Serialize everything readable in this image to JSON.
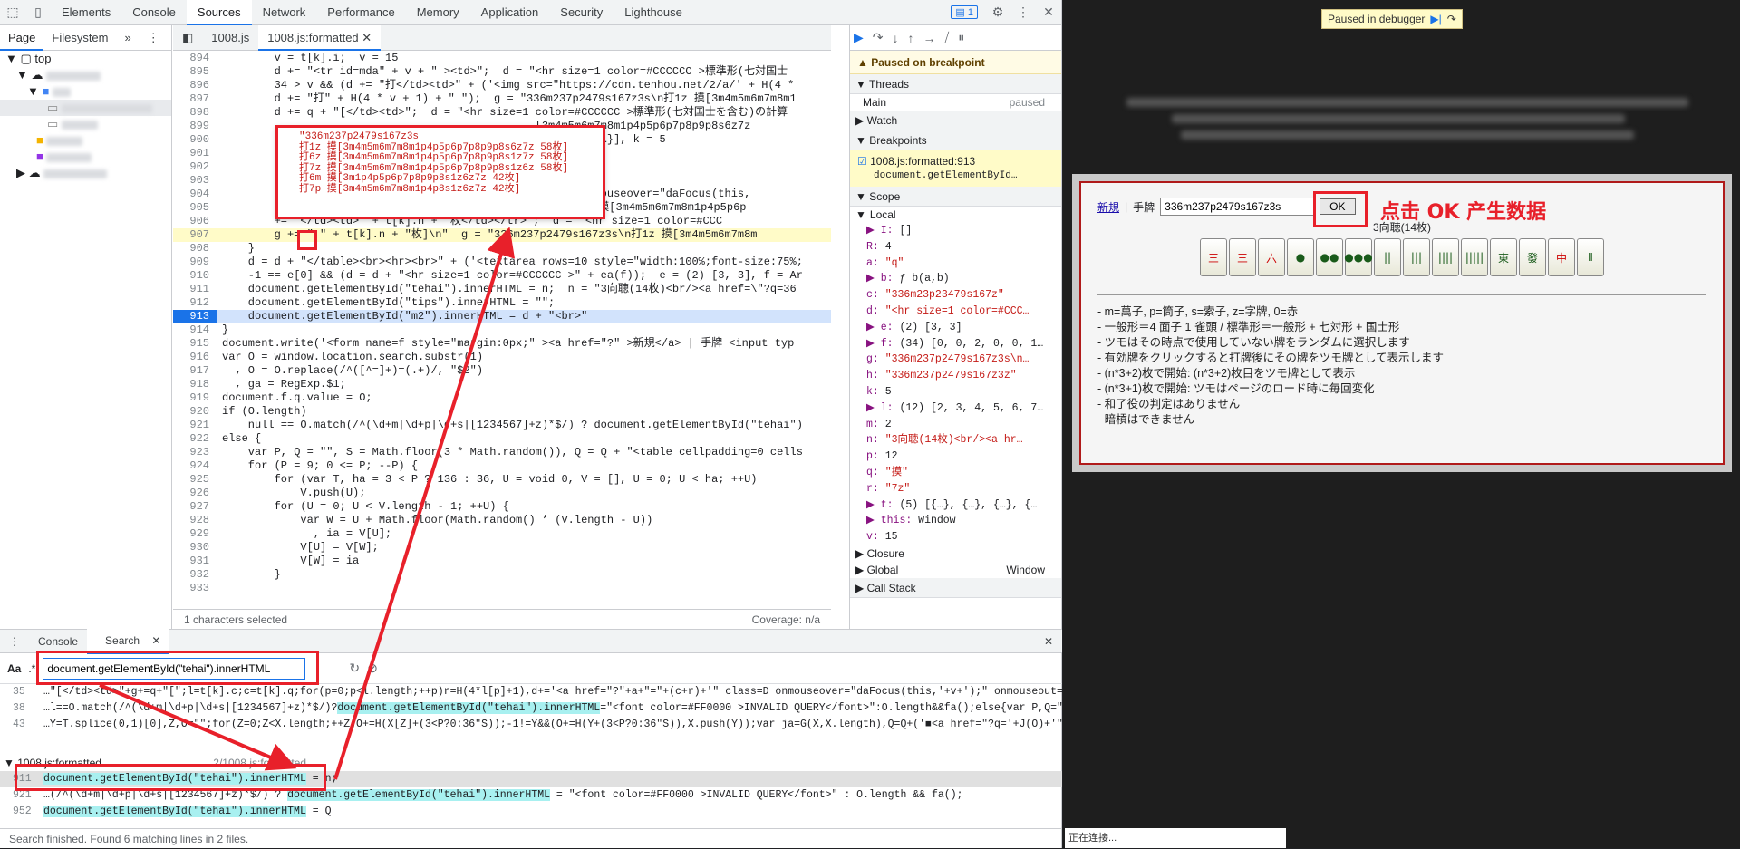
{
  "topbar": {
    "tabs": [
      "Elements",
      "Console",
      "Sources",
      "Network",
      "Performance",
      "Memory",
      "Application",
      "Security",
      "Lighthouse"
    ],
    "badge": "1"
  },
  "navigator": {
    "tabs": [
      "Page",
      "Filesystem"
    ],
    "top": "top"
  },
  "editor": {
    "tabs": [
      "1008.js",
      "1008.js:formatted"
    ],
    "lines": [
      {
        "n": "894",
        "t": "        v = t[k].i;  v = 15"
      },
      {
        "n": "895",
        "t": "        d += \"<tr id=mda\" + v + \" ><td>\";  d = \"<hr size=1 color=#CCCCCC >標準形(七対国士"
      },
      {
        "n": "896",
        "t": "        34 > v && (d += \"打</td><td>\" + ('<img src=\"https://cdn.tenhou.net/2/a/' + H(4 *"
      },
      {
        "n": "897",
        "t": "        d += \"打\" + H(4 * v + 1) + \" \");  g = \"336m237p2479s167z3s\\n打1z 摸[3m4m5m6m7m8m1"
      },
      {
        "n": "898",
        "t": "        d += q + \"[</td><td>\";  d = \"<hr size=1 color=#CCCCCC >標準形(七対国士を含む)の計算"
      },
      {
        "n": "899",
        "t": "                                                [3m4m5m6m7m8m1p4p5p6p7p8p9p8s6z7z"
      },
      {
        "n": "900",
        "t": "                                                …}, {…}, {…}], k = 5"
      },
      {
        "n": "901",
        "t": ""
      },
      {
        "n": "902",
        "t": "                                                ay(12)"
      },
      {
        "n": "903",
        "t": ""
      },
      {
        "n": "904",
        "t": "                                                lass=D onmouseover=\"daFocus(this,"
      },
      {
        "n": "905",
        "t": "                                                z3s\\n打1z 摸[3m4m5m6m7m8m1p4p5p6p"
      },
      {
        "n": "906",
        "t": "        += \"</td><td>\" + t[k].n + \"枚</td></tr>\";  d = \"<hr size=1 color=#CCC"
      },
      {
        "n": "907",
        "t": "        g += \" \" + t[k].n + \"枚]\\n\"  g = \"336m237p2479s167z3s\\n打1z 摸[3m4m5m6m7m8m"
      },
      {
        "n": "908",
        "t": "    }"
      },
      {
        "n": "909",
        "t": "    d = d + \"</table><br><hr><br>\" + ('<textarea rows=10 style=\"width:100%;font-size:75%;"
      },
      {
        "n": "910",
        "t": "    -1 == e[0] && (d = d + \"<hr size=1 color=#CCCCCC >\" + ea(f));  e = (2) [3, 3], f = Ar"
      },
      {
        "n": "911",
        "t": "    document.getElementById(\"tehai\").innerHTML = n;  n = \"3向聴(14枚)<br/><a href=\\\"?q=36"
      },
      {
        "n": "912",
        "t": "    document.getElementById(\"tips\").innerHTML = \"\";"
      },
      {
        "n": "913",
        "t": "    document.getElementById(\"m2\").innerHTML = d + \"<br>\""
      },
      {
        "n": "914",
        "t": "}"
      },
      {
        "n": "915",
        "t": "document.write('<form name=f style=\"margin:0px;\" ><a href=\"?\" >新規</a> | 手牌 <input typ"
      },
      {
        "n": "916",
        "t": "var O = window.location.search.substr(1)"
      },
      {
        "n": "917",
        "t": "  , O = O.replace(/^([^=]+)=(.+)/, \"$2\")"
      },
      {
        "n": "918",
        "t": "  , ga = RegExp.$1;"
      },
      {
        "n": "919",
        "t": "document.f.q.value = O;"
      },
      {
        "n": "920",
        "t": "if (O.length)"
      },
      {
        "n": "921",
        "t": "    null == O.match(/^(\\d+m|\\d+p|\\d+s|[1234567]+z)*$/) ? document.getElementById(\"tehai\")"
      },
      {
        "n": "922",
        "t": "else {"
      },
      {
        "n": "923",
        "t": "    var P, Q = \"\", S = Math.floor(3 * Math.random()), Q = Q + \"<table cellpadding=0 cells"
      },
      {
        "n": "924",
        "t": "    for (P = 9; 0 <= P; --P) {"
      },
      {
        "n": "925",
        "t": "        for (var T, ha = 3 < P ? 136 : 36, U = void 0, V = [], U = 0; U < ha; ++U)"
      },
      {
        "n": "926",
        "t": "            V.push(U);"
      },
      {
        "n": "927",
        "t": "        for (U = 0; U < V.length - 1; ++U) {"
      },
      {
        "n": "928",
        "t": "            var W = U + Math.floor(Math.random() * (V.length - U))"
      },
      {
        "n": "929",
        "t": "              , ia = V[U];"
      },
      {
        "n": "930",
        "t": "            V[U] = V[W];"
      },
      {
        "n": "931",
        "t": "            V[W] = ia"
      },
      {
        "n": "932",
        "t": "        }"
      },
      {
        "n": "933",
        "t": ""
      }
    ],
    "tooltip": "\"336m237p2479s167z3s\n打1z 摸[3m4m5m6m7m8m1p4p5p6p7p8p9p8s6z7z 58枚]\n打6z 摸[3m4m5m6m7m8m1p4p5p6p7p8p9p8s1z7z 58枚]\n打7z 摸[3m4m5m6m7m8m1p4p5p6p7p8p9p8s1z6z 58枚]\n打6m 摸[3m1p4p5p6p7p8p9p8s1z6z7z 42枚]\n打7p 摸[3m4m5m6m7m8m1p4p8s1z6z7z 42枚]",
    "status_left": "1 characters selected",
    "status_right": "Coverage: n/a"
  },
  "debugger": {
    "paused": "Paused on breakpoint",
    "threads_label": "Threads",
    "main_label": "Main",
    "main_status": "paused",
    "watch_label": "Watch",
    "breakpoints_label": "Breakpoints",
    "bp_file": "1008.js:formatted:913",
    "bp_code": "document.getElementById…",
    "scope_label": "Scope",
    "local_label": "Local",
    "scope": [
      [
        "▶ I:",
        " []"
      ],
      [
        "  R:",
        " 4"
      ],
      [
        "  a:",
        " \"q\""
      ],
      [
        "▶ b:",
        " ƒ b(a,b)"
      ],
      [
        "  c:",
        " \"336m23p23479s167z\""
      ],
      [
        "  d:",
        " \"<hr size=1 color=#CCC…"
      ],
      [
        "▶ e:",
        " (2) [3, 3]"
      ],
      [
        "▶ f:",
        " (34) [0, 0, 2, 0, 0, 1…"
      ],
      [
        "  g:",
        " \"336m237p2479s167z3s\\n…"
      ],
      [
        "  h:",
        " \"336m237p2479s167z3z\""
      ],
      [
        "  k:",
        " 5"
      ],
      [
        "▶ l:",
        " (12) [2, 3, 4, 5, 6, 7…"
      ],
      [
        "  m:",
        " 2"
      ],
      [
        "  n:",
        " \"3向聴(14枚)<br/><a hr…"
      ],
      [
        "  p:",
        " 12"
      ],
      [
        "  q:",
        " \"摸\""
      ],
      [
        "  r:",
        " \"7z\""
      ],
      [
        "▶ t:",
        " (5) [{…}, {…}, {…}, {…"
      ],
      [
        "▶ this:",
        " Window"
      ],
      [
        "  v:",
        " 15"
      ]
    ],
    "closure_label": "Closure",
    "global_label": "Global",
    "global_value": "Window",
    "callstack_label": "Call Stack"
  },
  "drawer": {
    "tabs": [
      "Console",
      "Search"
    ],
    "aa": "Aa",
    "regex": ".*",
    "query": "document.getElementById(\"tehai\").innerHTML",
    "results_top": [
      {
        "n": "35",
        "pre": "…\"[</td><td>\"+g+=q+\"[\";l=t[k].c;c=t[k].q;for(p=0;p<l.length;++p)r=H(4*l[p]+1),d+='<a href=\"?\"+a+\"=\"+(c+r)+'\" class=D onmouseover=\"daFocus(this,'+v+');\" onmouseout=\"daUnfocus();\">…",
        "m": "",
        "post": ""
      },
      {
        "n": "38",
        "pre": "…l==O.match(/^(\\d+m|\\d+p|\\d+s|[1234567]+z)*$/)?",
        "m": "document.getElementById(\"tehai\").innerHTML",
        "post": "=\"<font color=#FF0000 >INVALID QUERY</font>\":O.length&&fa();else{var P,Q=\"\",S=Math…"
      },
      {
        "n": "43",
        "pre": "…Y=T.splice(0,1)[0],Z,O=\"\";for(Z=0;Z<X.length;++Z)O+=H(X[Z]+(3<P?0:36\"S));-1!=Y&&(O+=H(Y+(3<P?0:36\"S)),X.push(Y));var ja=G(X,X.length),Q=Q+('■<a href=\"?q='+J(O)+'\" class=D >'),Q…",
        "m": "",
        "post": ""
      }
    ],
    "file2": "1008.js:formatted",
    "file2_path": "2/1008.js:formatted",
    "results_bottom": [
      {
        "n": "911",
        "pre": "",
        "m": "document.getElementById(\"tehai\").innerHTML",
        "post": " = n;"
      },
      {
        "n": "921",
        "pre": "…(/^(\\d+m|\\d+p|\\d+s|[1234567]+z)*$/) ? ",
        "m": "document.getElementById(\"tehai\").innerHTML",
        "post": " = \"<font color=#FF0000 >INVALID QUERY</font>\" : O.length && fa();"
      },
      {
        "n": "952",
        "pre": "",
        "m": "document.getElementById(\"tehai\").innerHTML",
        "post": " = Q"
      }
    ],
    "status": "Search finished.  Found 6 matching lines in 2 files."
  },
  "page": {
    "paused_banner": "Paused in debugger",
    "new_link": "新規",
    "hand_label": "手牌",
    "query_value": "336m237p2479s167z3s",
    "ok": "OK",
    "annotation": "点击 OK 产生数据",
    "shanten": "3向聴(14枚)",
    "tiles": [
      "三",
      "三",
      "六",
      "●",
      "●●",
      "●●●",
      "||",
      "|||",
      "||||",
      "|||||",
      "東",
      "發",
      "中",
      "Ⅱ"
    ],
    "rules": [
      "- m=萬子, p=筒子, s=索子, z=字牌, 0=赤",
      "- 一般形＝4 面子 1 雀頭 / 標準形＝一般形 + 七対形 + 国士形",
      "- ツモはその時点で使用していない牌をランダムに選択します",
      "- 有効牌をクリックすると打牌後にその牌をツモ牌として表示します",
      "- (n*3+2)枚で開始: (n*3+2)枚目をツモ牌として表示",
      "- (n*3+1)枚で開始: ツモはページのロード時に毎回変化",
      "- 和了役の判定はありません",
      "- 暗槓はできません"
    ],
    "connecting": "正在连接..."
  },
  "colors": {
    "annotation_red": "#e8202a",
    "accent": "#1a73e8"
  }
}
